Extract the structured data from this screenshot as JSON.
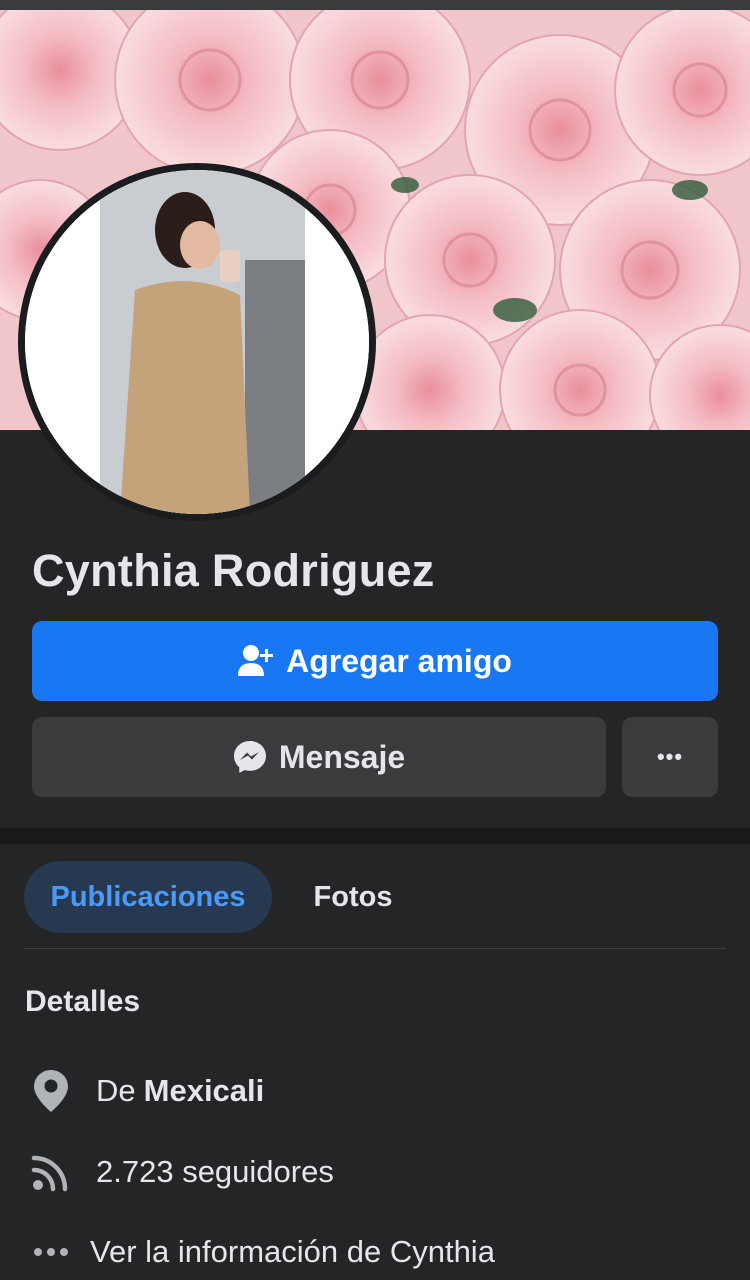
{
  "profile": {
    "name": "Cynthia Rodriguez"
  },
  "actions": {
    "add_friend_label": "Agregar amigo",
    "message_label": "Mensaje",
    "more_label": "•••"
  },
  "tabs": [
    {
      "label": "Publicaciones",
      "active": true
    },
    {
      "label": "Fotos",
      "active": false
    }
  ],
  "details": {
    "title": "Detalles",
    "from_prefix": "De",
    "from_city": "Mexicali",
    "followers": "2.723 seguidores",
    "more_info": "Ver la información de Cynthia"
  },
  "colors": {
    "background": "#242526",
    "primary_button": "#1877f2",
    "secondary_button": "#3a3b3c",
    "active_tab_bg": "#263951",
    "active_tab_text": "#4c9af8"
  },
  "icons": {
    "add_friend": "person-plus-icon",
    "messenger": "messenger-icon",
    "location": "location-pin-icon",
    "followers": "rss-feed-icon",
    "more": "ellipsis-icon"
  }
}
